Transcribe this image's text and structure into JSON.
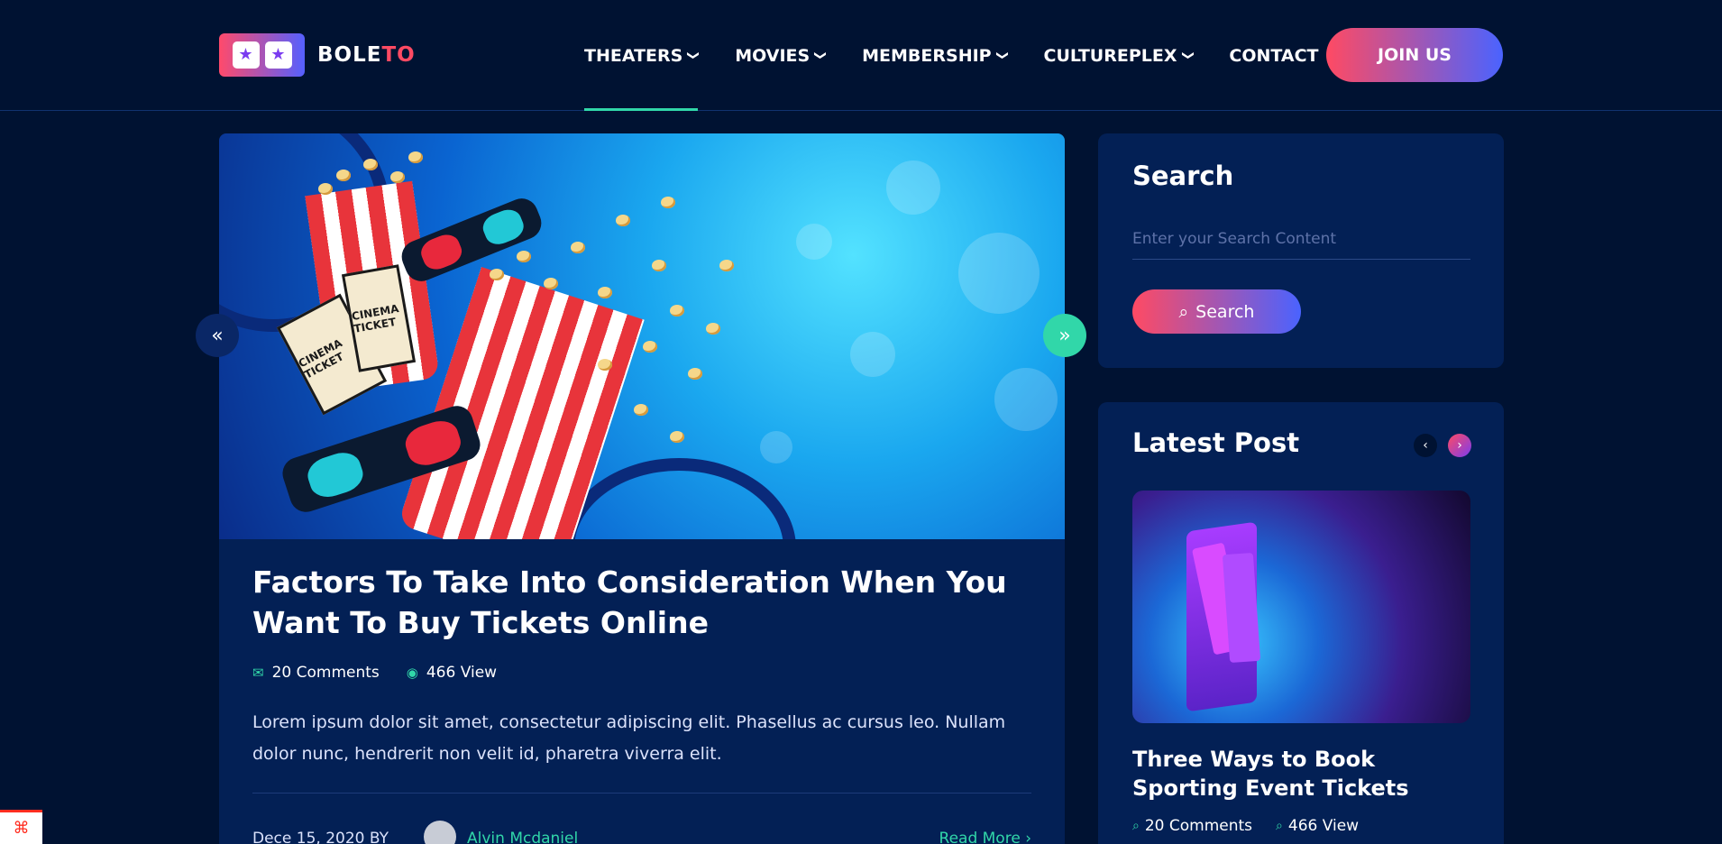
{
  "brand": {
    "name_part1": "BOLE",
    "name_part2": "TO",
    "logo_icon": "star-ticket-icon",
    "colors": {
      "accent": "#31d7a9",
      "red": "#ff4a63",
      "blue": "#4a63ff",
      "background": "#001232",
      "card": "#032055"
    }
  },
  "nav": {
    "items": [
      {
        "label": "THEATERS",
        "has_dropdown": true
      },
      {
        "label": "MOVIES",
        "has_dropdown": true
      },
      {
        "label": "MEMBERSHIP",
        "has_dropdown": true
      },
      {
        "label": "CULTUREPLEX",
        "has_dropdown": true
      },
      {
        "label": "CONTACT",
        "has_dropdown": false
      }
    ],
    "active_index": 0,
    "join_label": "JOIN US"
  },
  "post": {
    "title": "Factors To Take Into Consideration When You Want To Buy Tickets Online",
    "comments": "20 Comments",
    "views": "466 View",
    "excerpt": "Lorem ipsum dolor sit amet, consectetur adipiscing elit. Phasellus ac cursus leo. Nullam dolor nunc, hendrerit non velit id, pharetra viverra elit.",
    "date_by": "Dece 15, 2020 BY",
    "author": "Alvin Mcdaniel",
    "read_more": "Read More",
    "ticket_text": "CINEMA TICKET",
    "prev_icon": "double-chevron-left-icon",
    "next_icon": "double-chevron-right-icon"
  },
  "sidebar": {
    "search": {
      "title": "Search",
      "placeholder": "Enter your Search Content",
      "button_label": "Search"
    },
    "latest": {
      "title": "Latest Post",
      "post_title": "Three Ways to Book Sporting Event Tickets",
      "comments": "20 Comments",
      "views": "466 View"
    }
  }
}
